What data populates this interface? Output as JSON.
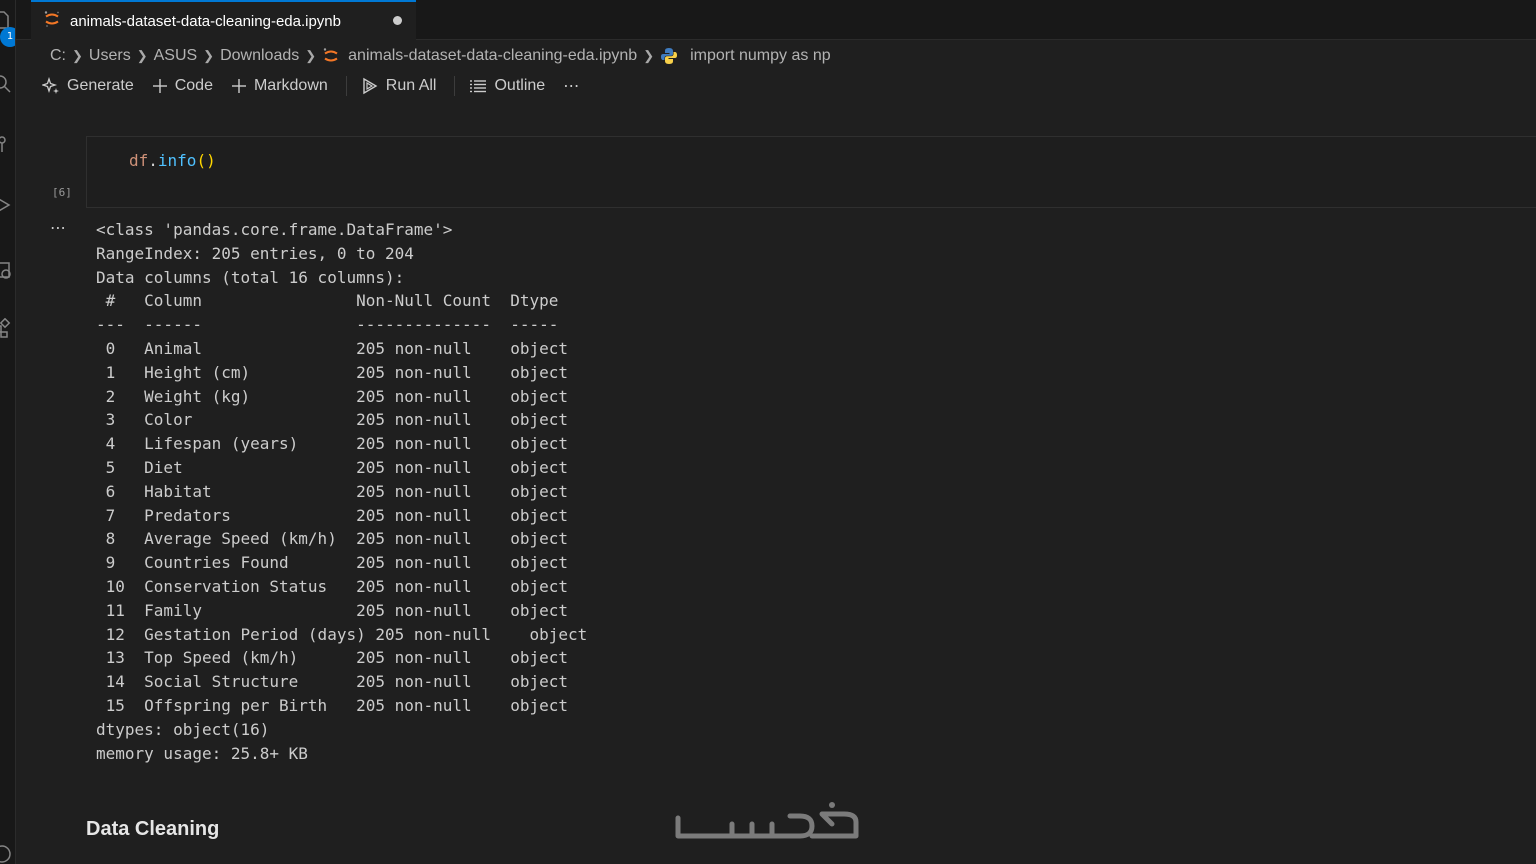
{
  "activity_bar": {
    "badge": "1"
  },
  "tab": {
    "title": "animals-dataset-data-cleaning-eda.ipynb"
  },
  "breadcrumb": {
    "items": [
      "C:",
      "Users",
      "ASUS",
      "Downloads",
      "animals-dataset-data-cleaning-eda.ipynb",
      "import numpy as np"
    ]
  },
  "toolbar": {
    "generate": "Generate",
    "code": "Code",
    "markdown": "Markdown",
    "run_all": "Run All",
    "outline": "Outline",
    "more": "⋯"
  },
  "cell": {
    "code_var": "df",
    "code_dot": ".",
    "code_fn": "info",
    "code_parens": "()",
    "exec_count": "[6]"
  },
  "output": {
    "more": "⋯",
    "lines": [
      "<class 'pandas.core.frame.DataFrame'>",
      "RangeIndex: 205 entries, 0 to 204",
      "Data columns (total 16 columns):",
      " #   Column                Non-Null Count  Dtype ",
      "---  ------                --------------  ----- ",
      " 0   Animal                205 non-null    object",
      " 1   Height (cm)           205 non-null    object",
      " 2   Weight (kg)           205 non-null    object",
      " 3   Color                 205 non-null    object",
      " 4   Lifespan (years)      205 non-null    object",
      " 5   Diet                  205 non-null    object",
      " 6   Habitat               205 non-null    object",
      " 7   Predators             205 non-null    object",
      " 8   Average Speed (km/h)  205 non-null    object",
      " 9   Countries Found       205 non-null    object",
      " 10  Conservation Status   205 non-null    object",
      " 11  Family                205 non-null    object",
      " 12  Gestation Period (days) 205 non-null    object",
      " 13  Top Speed (km/h)      205 non-null    object",
      " 14  Social Structure      205 non-null    object",
      " 15  Offspring per Birth   205 non-null    object",
      "dtypes: object(16)",
      "memory usage: 25.8+ KB"
    ]
  },
  "markdown": {
    "heading": "Data Cleaning"
  },
  "watermark": {
    "text": "خمسات"
  }
}
